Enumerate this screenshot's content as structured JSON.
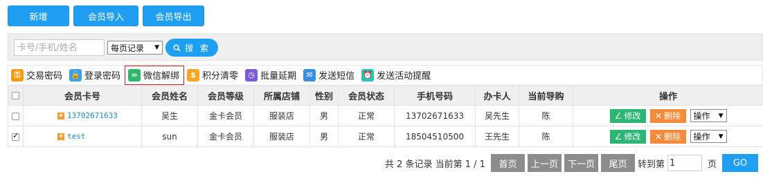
{
  "top_buttons": {
    "add": "新增",
    "import": "会员导入",
    "export": "会员导出"
  },
  "search": {
    "placeholder": "卡号/手机/姓名",
    "per_page": "每页记录",
    "button": "搜 索"
  },
  "toolbar": [
    {
      "label": "交易密码",
      "icon": "key-icon",
      "color": "#f39c12",
      "glyph": "⚿"
    },
    {
      "label": "登录密码",
      "icon": "lock-icon",
      "color": "#3ba2e8",
      "glyph": "🔒"
    },
    {
      "label": "微信解绑",
      "icon": "link-icon",
      "color": "#2fb66a",
      "glyph": "∞"
    },
    {
      "label": "积分清零",
      "icon": "coin-icon",
      "color": "#f5a623",
      "glyph": "$"
    },
    {
      "label": "批量延期",
      "icon": "clock-icon",
      "color": "#7b5bd6",
      "glyph": "◷"
    },
    {
      "label": "发送短信",
      "icon": "mail-icon",
      "color": "#3b8de0",
      "glyph": "✉"
    },
    {
      "label": "发送活动提醒",
      "icon": "alarm-icon",
      "color": "#21c6b5",
      "glyph": "⏰"
    }
  ],
  "table": {
    "headers": [
      "会员卡号",
      "会员姓名",
      "会员等级",
      "所属店铺",
      "性别",
      "会员状态",
      "手机号码",
      "办卡人",
      "当前导购",
      "操作"
    ],
    "rows": [
      {
        "card": "13702671633",
        "name": "吴生",
        "level": "金卡会员",
        "store": "服装店",
        "gender": "男",
        "status": "正常",
        "phone": "13702671633",
        "issuer": "吴先生",
        "guide": "陈",
        "checked": false
      },
      {
        "card": "test",
        "name": "sun",
        "level": "金卡会员",
        "store": "服装店",
        "gender": "男",
        "status": "正常",
        "phone": "18504510500",
        "issuer": "王先生",
        "guide": "陈",
        "checked": true
      }
    ],
    "edit_label": "修改",
    "delete_label": "删除",
    "op_label": "操作"
  },
  "pager": {
    "summary": "共 2 条记录 当前第 1 / 1",
    "first": "首页",
    "prev": "上一页",
    "next": "下一页",
    "last": "尾页",
    "goto_label": "转到第",
    "page_value": "1",
    "page_unit": "页",
    "go": "GO"
  },
  "colors": {
    "primary": "#1e9ff2",
    "edit": "#2bb673",
    "delete": "#f58a3a",
    "pager_gray": "#8c8c8c",
    "link": "#1e88c7"
  }
}
